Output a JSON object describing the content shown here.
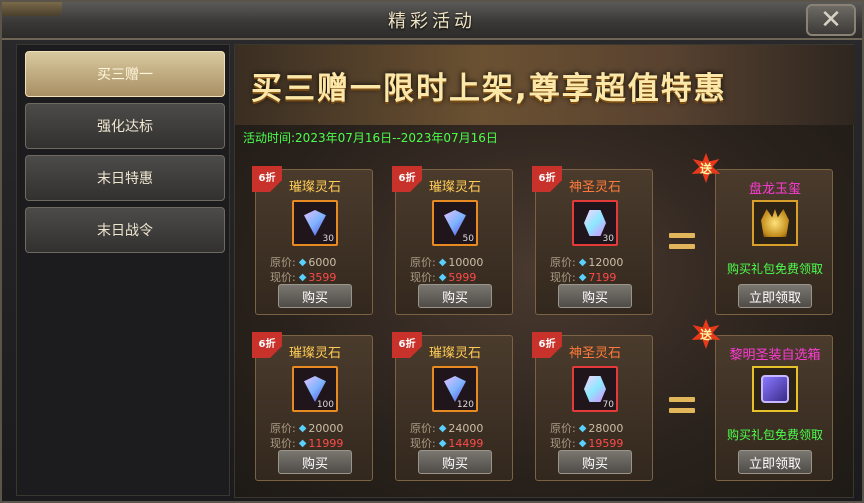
{
  "window": {
    "title": "精彩活动",
    "close_icon": "close-icon"
  },
  "sidebar": {
    "tabs": [
      {
        "label": "买三赠一",
        "active": true
      },
      {
        "label": "强化达标",
        "active": false
      },
      {
        "label": "末日特惠",
        "active": false
      },
      {
        "label": "末日战令",
        "active": false
      }
    ]
  },
  "banner": {
    "headline": "买三赠一限时上架,尊享超值特惠",
    "time_label": "活动时间:",
    "time_value": "2023年07月16日--2023年07月16日"
  },
  "labels": {
    "original": "原价:",
    "current": "现价:",
    "buy": "购买",
    "claim": "立即领取",
    "gift_desc": "购买礼包免费领取",
    "discount": "6折",
    "send": "送"
  },
  "rows": [
    {
      "items": [
        {
          "name": "璀璨灵石",
          "qty": "30",
          "original": "6000",
          "current": "3599",
          "type": "radiant"
        },
        {
          "name": "璀璨灵石",
          "qty": "50",
          "original": "10000",
          "current": "5999",
          "type": "radiant"
        },
        {
          "name": "神圣灵石",
          "qty": "30",
          "original": "12000",
          "current": "7199",
          "type": "holy"
        }
      ],
      "gift": {
        "name": "盘龙玉玺",
        "icon": "crown-seal-icon"
      }
    },
    {
      "items": [
        {
          "name": "璀璨灵石",
          "qty": "100",
          "original": "20000",
          "current": "11999",
          "type": "radiant"
        },
        {
          "name": "璀璨灵石",
          "qty": "120",
          "original": "24000",
          "current": "14499",
          "type": "radiant"
        },
        {
          "name": "神圣灵石",
          "qty": "70",
          "original": "28000",
          "current": "19599",
          "type": "holy"
        }
      ],
      "gift": {
        "name": "黎明圣装自选箱",
        "icon": "chest-icon"
      }
    }
  ],
  "colors": {
    "accent_gold": "#e2b65a",
    "price_now": "#ff4a4a",
    "green_text": "#4cff4c",
    "gift_name": "#ff3ad6"
  }
}
